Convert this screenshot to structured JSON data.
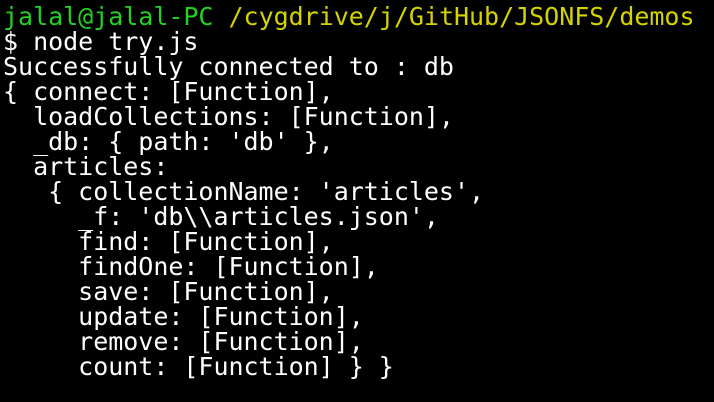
{
  "terminal": {
    "prompt": {
      "user_host": "jalal@jalal-PC",
      "path": "/cygdrive/j/GitHub/JSONFS/demos"
    },
    "command_line": "$ node try.js",
    "output": [
      "Successfully connected to : db",
      "{ connect: [Function],",
      "  loadCollections: [Function],",
      "  _db: { path: 'db' },",
      "  articles:",
      "   { collectionName: 'articles',",
      "     _f: 'db\\\\articles.json',",
      "     find: [Function],",
      "     findOne: [Function],",
      "     save: [Function],",
      "     update: [Function],",
      "     remove: [Function],",
      "     count: [Function] } }"
    ]
  },
  "colors": {
    "background": "#000000",
    "prompt_user_host": "#22d122",
    "prompt_path": "#d4d400",
    "text": "#ffffff"
  }
}
